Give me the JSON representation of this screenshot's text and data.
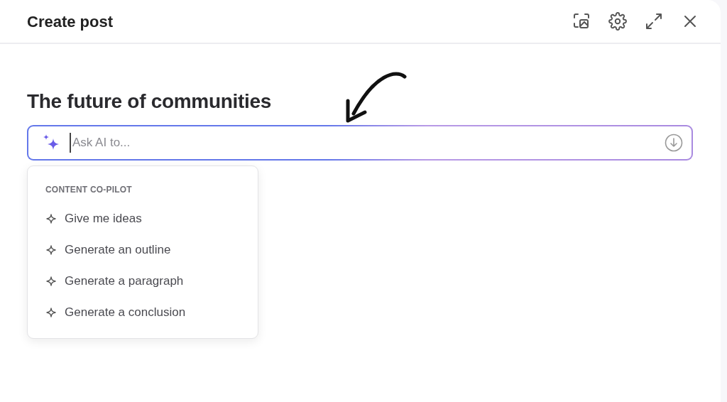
{
  "dialog": {
    "title": "Create post"
  },
  "post": {
    "title": "The future of communities"
  },
  "ai_input": {
    "placeholder": "Ask AI to..."
  },
  "menu": {
    "section_label": "CONTENT CO-PILOT",
    "items": [
      {
        "label": "Give me ideas"
      },
      {
        "label": "Generate an outline"
      },
      {
        "label": "Generate a paragraph"
      },
      {
        "label": "Generate a conclusion"
      }
    ]
  }
}
